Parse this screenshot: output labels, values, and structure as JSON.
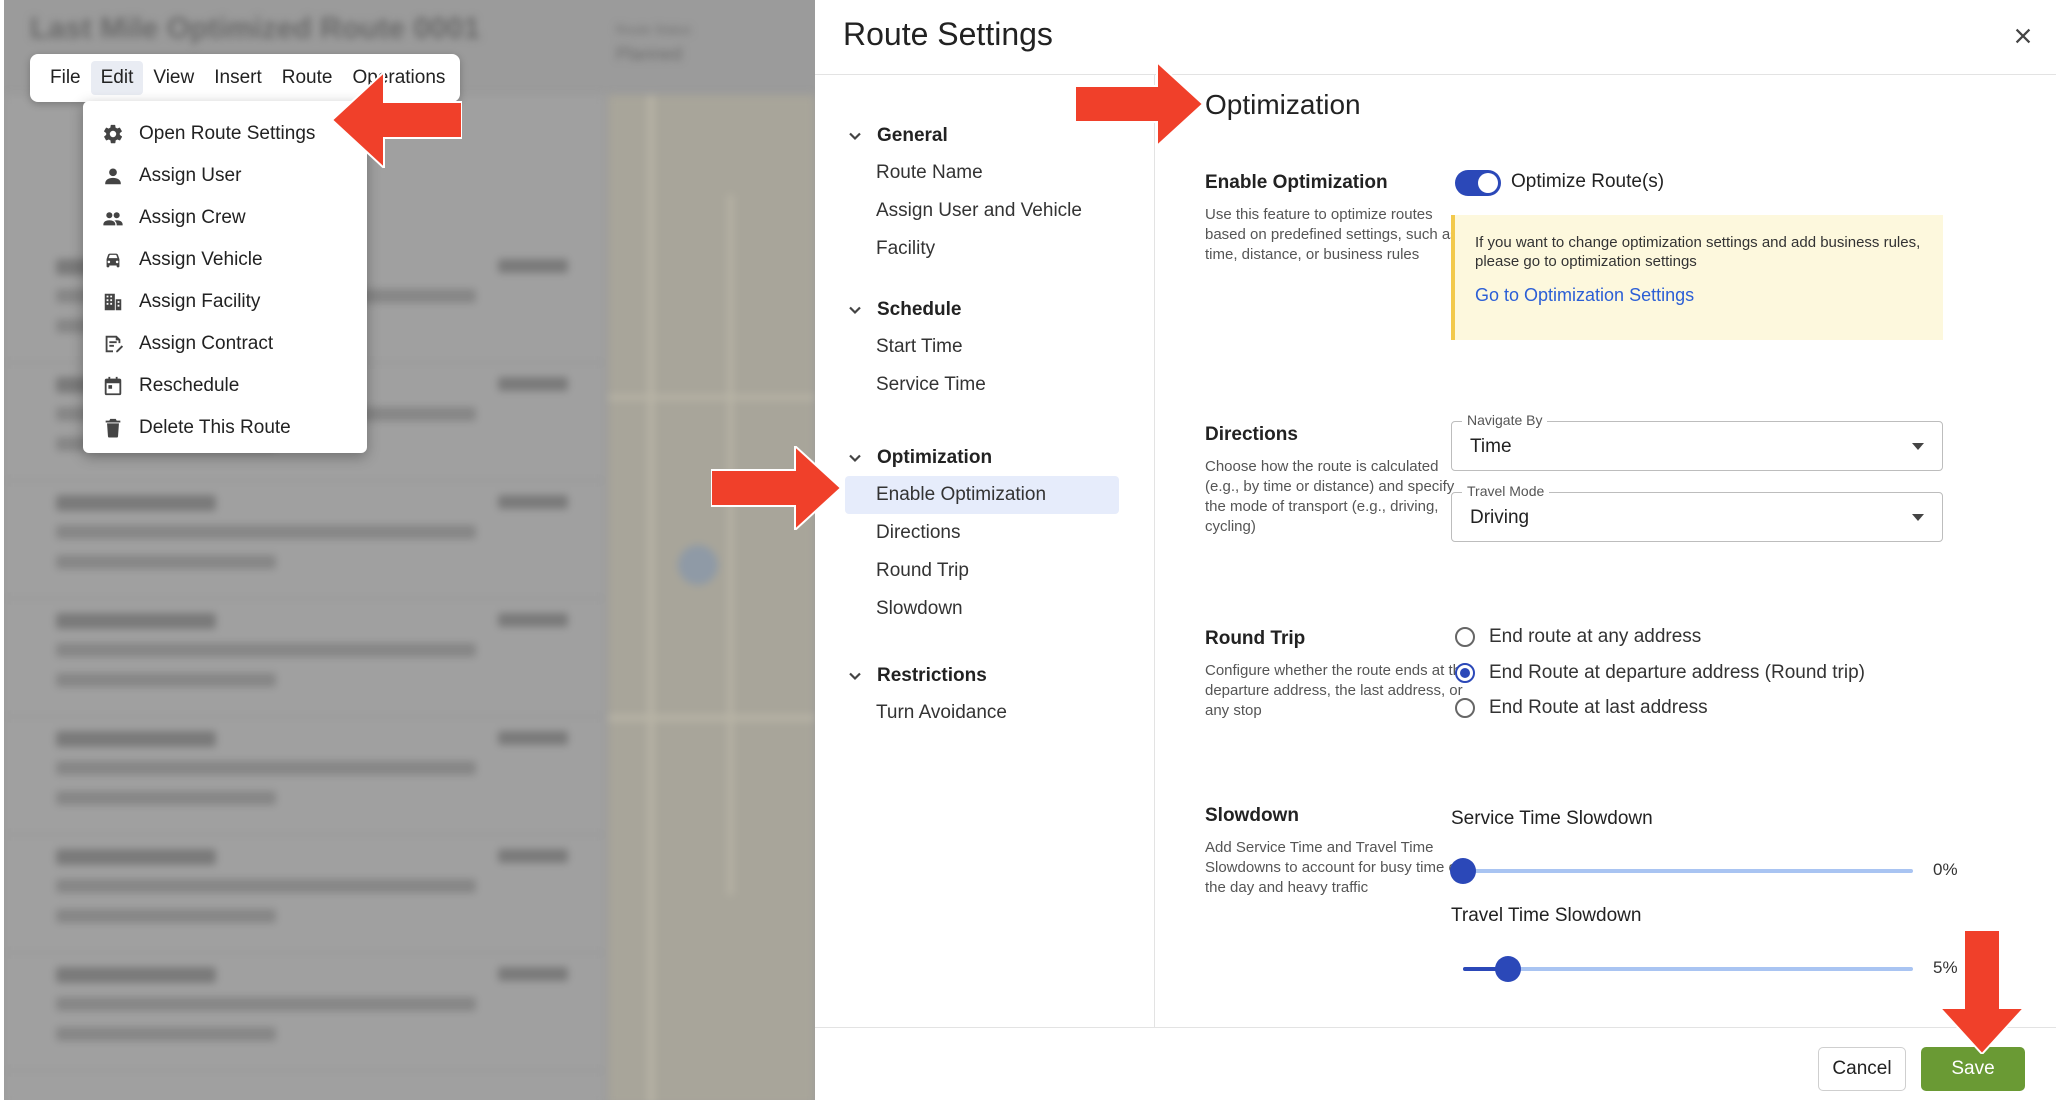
{
  "background_app": {
    "title": "Last Mile Optimized Route 0001",
    "status_label": "Route Status",
    "status_value": "Planned"
  },
  "menubar": {
    "tabs": [
      {
        "label": "File"
      },
      {
        "label": "Edit"
      },
      {
        "label": "View"
      },
      {
        "label": "Insert"
      },
      {
        "label": "Route"
      },
      {
        "label": "Operations"
      }
    ],
    "active_tab": "Edit"
  },
  "edit_menu": {
    "items": [
      {
        "label": "Open Route Settings",
        "icon": "gear-icon"
      },
      {
        "label": "Assign User",
        "icon": "user-icon"
      },
      {
        "label": "Assign Crew",
        "icon": "crew-icon"
      },
      {
        "label": "Assign Vehicle",
        "icon": "vehicle-icon"
      },
      {
        "label": "Assign Facility",
        "icon": "facility-icon"
      },
      {
        "label": "Assign Contract",
        "icon": "contract-icon"
      },
      {
        "label": "Reschedule",
        "icon": "calendar-icon"
      },
      {
        "label": "Delete This Route",
        "icon": "trash-icon"
      }
    ]
  },
  "dialog": {
    "title": "Route Settings",
    "nav": {
      "groups": [
        {
          "label": "General",
          "items": [
            "Route Name",
            "Assign User and Vehicle",
            "Facility"
          ]
        },
        {
          "label": "Schedule",
          "items": [
            "Start Time",
            "Service Time"
          ]
        },
        {
          "label": "Optimization",
          "items": [
            "Enable Optimization",
            "Directions",
            "Round Trip",
            "Slowdown"
          ]
        },
        {
          "label": "Restrictions",
          "items": [
            "Turn Avoidance"
          ]
        }
      ],
      "selected_item": "Enable Optimization"
    },
    "content": {
      "heading": "Optimization",
      "enable": {
        "title": "Enable Optimization",
        "description": "Use this feature to optimize routes based on predefined settings, such as time, distance, or business rules",
        "toggle_label": "Optimize Route(s)",
        "toggle_on": true,
        "notice_text": "If you want to change optimization settings and add business rules, please go to optimization settings",
        "notice_link": "Go to Optimization Settings"
      },
      "directions": {
        "title": "Directions",
        "description": "Choose how the route is calculated (e.g., by time or distance) and specify the mode of transport (e.g., driving, cycling)",
        "navigate_by_label": "Navigate By",
        "navigate_by_value": "Time",
        "travel_mode_label": "Travel Mode",
        "travel_mode_value": "Driving"
      },
      "round_trip": {
        "title": "Round Trip",
        "description": "Configure whether the route ends at the departure address, the last address, or any stop",
        "options": [
          {
            "label": "End route at any address",
            "checked": false
          },
          {
            "label": "End Route at departure address (Round trip)",
            "checked": true
          },
          {
            "label": "End Route at last address",
            "checked": false
          }
        ]
      },
      "slowdown": {
        "title": "Slowdown",
        "description": "Add Service Time and Travel Time Slowdowns to account for busy time of the day and heavy traffic",
        "service_label": "Service Time Slowdown",
        "service_value": "0%",
        "service_fraction": 0.0,
        "travel_label": "Travel Time Slowdown",
        "travel_value": "5%",
        "travel_fraction": 0.1
      }
    },
    "footer": {
      "cancel_label": "Cancel",
      "save_label": "Save"
    }
  },
  "colors": {
    "accent": "#2b48b8",
    "save": "#6a9a34",
    "arrow": "#f0402a",
    "notice_bg": "#fdf8dd",
    "link": "#2c5fd6"
  }
}
